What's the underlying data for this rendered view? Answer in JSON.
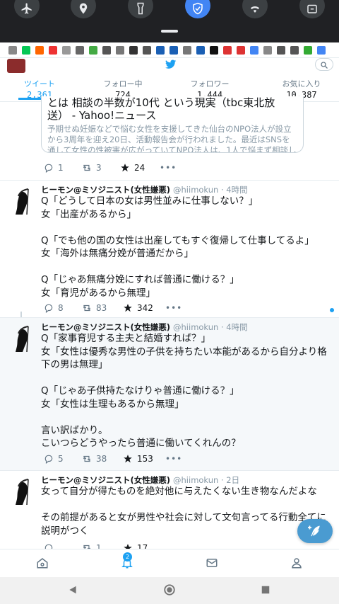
{
  "quick_settings": {
    "tiles": [
      "airplane-icon",
      "location-icon",
      "flashlight-icon",
      "vpn-shield-icon",
      "wifi-icon",
      "battery-saver-icon"
    ],
    "active_tile": "vpn-shield-icon"
  },
  "notification_bar": {
    "icons": [
      "gallery-icon",
      "line-icon",
      "au-icon",
      "bank-icon",
      "fish-icon",
      "camera-icon",
      "app-icon",
      "app-icon",
      "news-icon",
      "alert-icon",
      "back-arrow-icon",
      "building-icon",
      "building-icon",
      "mail-icon",
      "building-icon",
      "tiktok-icon",
      "gmail-icon",
      "gmail-icon",
      "google-icon",
      "app-icon",
      "check-icon",
      "check-icon",
      "play-icon",
      "maps-icon"
    ]
  },
  "profile_strip": {
    "bird": "twitter-bird-icon",
    "search": "search-icon"
  },
  "stats": [
    {
      "label": "ツイート",
      "value": "2,361"
    },
    {
      "label": "フォロー中",
      "value": "724"
    },
    {
      "label": "フォロワー",
      "value": "1,444"
    },
    {
      "label": "お気に入り",
      "value": "10,387"
    }
  ],
  "embed": {
    "title_line1": "とは 相談の半数が10代 という現実（tbc東北放",
    "title_line2": "送） - Yahoo!ニュース",
    "desc": "予期せぬ妊娠などで悩む女性を支援してきた仙台のNPO法人が設立から3周年を迎え20日、活動報告会が行われました。最近はSNSを通して女性の性被害が広がっていてNPO法人は、1人で悩まず相談してほしい",
    "actions": {
      "reply": "1",
      "retweet": "3",
      "like": "24"
    }
  },
  "tweets": [
    {
      "name": "ヒーモン@ミソジニスト(女性嫌悪)",
      "meta": "@hiimokun · 4時間",
      "body": "Q「どうして日本の女は男性並みに仕事しない？」\n女「出産があるから」\n\nQ「でも他の国の女性は出産してもすぐ復帰して仕事してるよ」\n女「海外は無痛分娩が普通だから」\n\nQ「じゃあ無痛分娩にすれば普通に働ける？」\n女「育児があるから無理」",
      "actions": {
        "reply": "8",
        "retweet": "83",
        "like": "342"
      }
    },
    {
      "name": "ヒーモン@ミソジニスト(女性嫌悪)",
      "meta": "@hiimokun · 4時間",
      "body": "Q「家事育児する主夫と結婚すれば？」\n女「女性は優秀な男性の子供を持ちたい本能があるから自分より格下の男は無理」\n\nQ「じゃあ子供持たなけりゃ普通に働ける？」\n女「女性は生理もあるから無理」\n\n言い訳ばかり。\nこいつらどうやったら普通に働いてくれんの？",
      "actions": {
        "reply": "5",
        "retweet": "38",
        "like": "153"
      }
    },
    {
      "name": "ヒーモン@ミソジニスト(女性嫌悪)",
      "meta": "@hiimokun · 2日",
      "body": "女って自分が得たものを絶対他に与えたくない生き物なんだよな\n\nその前提があると女が男性や社会に対して文句言ってる行動全てに説明がつく",
      "actions": {
        "reply": "",
        "retweet": "1",
        "like": "17"
      }
    }
  ],
  "compose": {
    "icon": "compose-feather-icon"
  },
  "tabbar": {
    "notifications_badge": "2"
  },
  "colors": {
    "accent": "#1da1f2",
    "fab": "#4a9bd1",
    "qs_bg": "#202124"
  }
}
